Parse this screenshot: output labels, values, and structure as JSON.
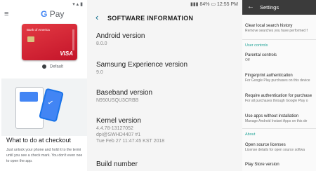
{
  "gpay": {
    "status_time": "",
    "app_title_g": "G",
    "app_title_pay": "Pay",
    "card": {
      "bank": "Bank of America",
      "network": "VISA"
    },
    "default_label": "Default",
    "promo_heading": "What to do at checkout",
    "promo_lines": [
      "Just unlock your phone and hold it to the termi",
      "until you see a check mark. You don't even nee",
      "to open the app."
    ]
  },
  "software": {
    "status_battery": "84%",
    "status_time": "12:55 PM",
    "title": "SOFTWARE INFORMATION",
    "items": [
      {
        "label": "Android version",
        "value": "8.0.0"
      },
      {
        "label": "Samsung Experience version",
        "value": "9.0"
      },
      {
        "label": "Baseband version",
        "value": "N950USQU3CRBB"
      },
      {
        "label": "Kernel version",
        "value_lines": [
          "4.4.78-13127052",
          "dpi@SWHD4407 #1",
          "Tue Feb 27 11:47:45 KST 2018"
        ]
      },
      {
        "label": "Build number",
        "value": ""
      }
    ]
  },
  "settings": {
    "title": "Settings",
    "items_top": [
      {
        "title": "Clear local search history",
        "subtitle": "Remove searches you have performed f"
      }
    ],
    "section_user_controls": "User controls",
    "items_user": [
      {
        "title": "Parental controls",
        "subtitle": "Off"
      },
      {
        "title": "Fingerprint authentication",
        "subtitle": "For Google Play purchases on this device"
      },
      {
        "title": "Require authentication for purchase",
        "subtitle": "For all purchases through Google Play o"
      },
      {
        "title": "Use apps without installation",
        "subtitle": "Manage Android Instant Apps on this de"
      }
    ],
    "section_about": "About",
    "items_about": [
      {
        "title": "Open source licenses",
        "subtitle": "License details for open source softwa"
      },
      {
        "title": "Play Store version",
        "subtitle": ""
      }
    ]
  }
}
